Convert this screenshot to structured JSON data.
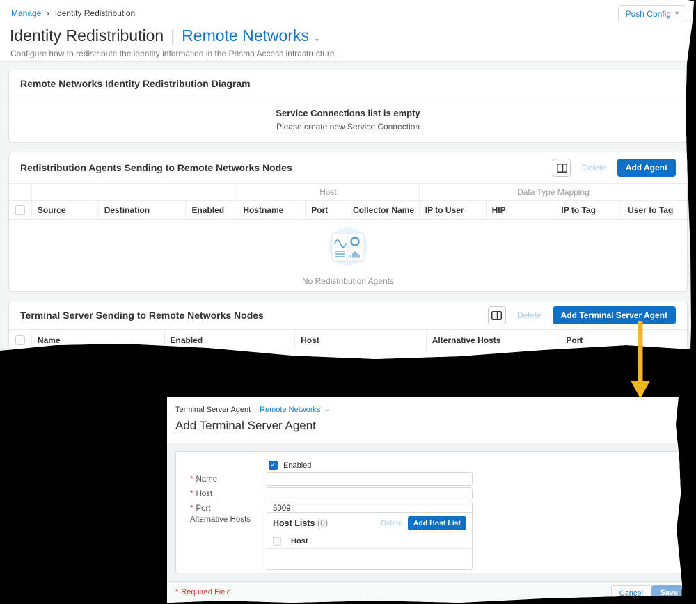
{
  "page": {
    "breadcrumb": {
      "manage": "Manage",
      "current": "Identity Redistribution"
    },
    "push_config_label": "Push Config",
    "title": "Identity Redistribution",
    "title_pipe": "|",
    "title_selector": "Remote Networks",
    "subtitle": "Configure how to redistribute the identity information in the Prisma Access infrastructure."
  },
  "diagram_card": {
    "title": "Remote Networks Identity Redistribution Diagram",
    "empty_title": "Service Connections list is empty",
    "empty_subtitle": "Please create new Service Connection"
  },
  "agents_card": {
    "title": "Redistribution Agents Sending to Remote Networks Nodes",
    "delete_label": "Delete",
    "add_label": "Add Agent",
    "group_headers": {
      "host": "Host",
      "data_type_mapping": "Data Type Mapping"
    },
    "columns": [
      "Source",
      "Destination",
      "Enabled",
      "Hostname",
      "Port",
      "Collector Name",
      "IP to User",
      "HIP",
      "IP to Tag",
      "User to Tag"
    ],
    "empty_text": "No Redistribution Agents"
  },
  "terminal_card": {
    "title": "Terminal Server Sending to Remote Networks Nodes",
    "delete_label": "Delete",
    "add_label": "Add Terminal Server Agent",
    "columns": [
      "Name",
      "Enabled",
      "Host",
      "Alternative Hosts",
      "Port"
    ]
  },
  "dialog": {
    "breadcrumb_title": "Terminal Server Agent",
    "breadcrumb_pipe": "|",
    "breadcrumb_selector": "Remote Networks",
    "title": "Add Terminal Server Agent",
    "required_marker": "*",
    "enabled_label": "Enabled",
    "name_label": "Name",
    "host_label": "Host",
    "port_label": "Port",
    "port_value": "5009",
    "alt_hosts_label": "Alternative Hosts",
    "host_lists_title": "Host Lists",
    "host_lists_count": "(0)",
    "delete_label": "Delete",
    "add_host_list_label": "Add Host List",
    "host_column": "Host",
    "required_note": "Required Field",
    "cancel_label": "Cancel",
    "save_label": "Save",
    "check_glyph": "✓"
  },
  "colors": {
    "accent_blue": "#1070C4",
    "link_blue": "#147CC6",
    "disabled_blue": "#A9CDEC",
    "save_disabled": "#7FB2E0",
    "required_red": "#D13C3C",
    "arrow_gold": "#F2B71F",
    "page_bg": "#F4F5F5"
  }
}
